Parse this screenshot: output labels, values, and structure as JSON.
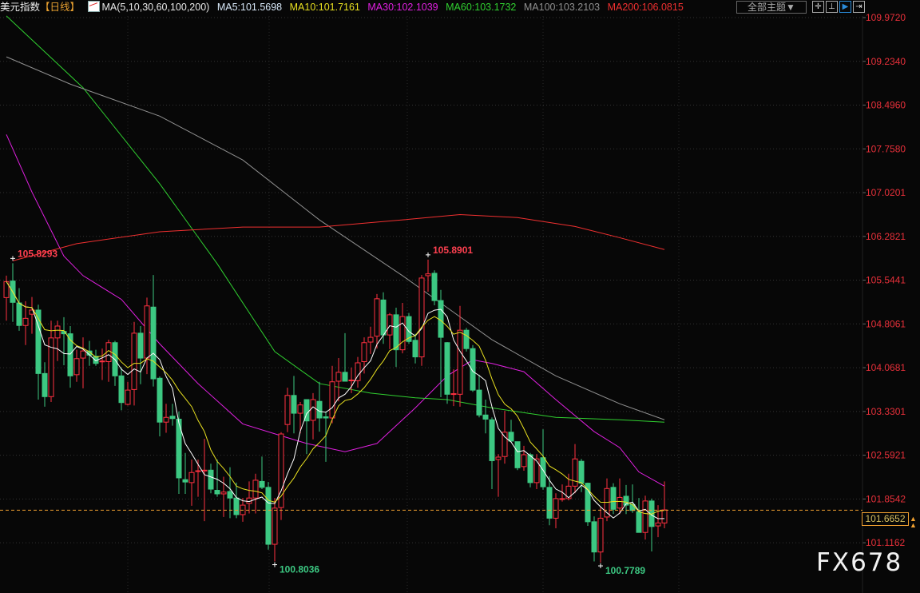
{
  "header": {
    "title": "美元指数",
    "period": "【日线】",
    "ma_spec": "MA(5,10,30,60,100,200)",
    "ma5": "MA5:101.5698",
    "ma10": "MA10:101.7161",
    "ma30": "MA30:102.1039",
    "ma60": "MA60:103.1732",
    "ma100": "MA100:103.2103",
    "ma200": "MA200:106.0815",
    "theme_button": "全部主题▼",
    "toolbar_icons": [
      "crosshair-icon",
      "range-select-icon",
      "draw-line-icon",
      "move-right-icon"
    ]
  },
  "colors": {
    "up": "#ff3040",
    "down": "#3cc882",
    "ma5": "#ffffff",
    "ma10": "#e8e020",
    "ma30": "#e020e0",
    "ma60": "#30d030",
    "ma100": "#909090",
    "ma200": "#f03030",
    "axis": "#e8303a"
  },
  "current_price": "101.6652",
  "watermark": "FX678",
  "chart_data": {
    "type": "candlestick",
    "title": "美元指数 日线",
    "ylim": [
      100.66,
      110.06
    ],
    "y_ticks": [
      "109.9720",
      "109.2340",
      "108.4960",
      "107.7580",
      "107.0201",
      "106.2821",
      "105.5441",
      "104.8061",
      "104.0681",
      "103.3301",
      "102.5921",
      "101.8542",
      "101.1162"
    ],
    "annotations": [
      {
        "bar": 2,
        "text": "105.8293",
        "type": "high"
      },
      {
        "bar": 67,
        "text": "105.8901",
        "type": "high"
      },
      {
        "bar": 43,
        "text": "100.8036",
        "type": "low"
      },
      {
        "bar": 94,
        "text": "100.7789",
        "type": "low"
      }
    ],
    "ohlc": [
      [
        105.25,
        105.62,
        104.86,
        105.52
      ],
      [
        105.53,
        105.83,
        104.84,
        105.17
      ],
      [
        105.16,
        105.41,
        104.69,
        104.78
      ],
      [
        104.78,
        105.19,
        104.45,
        104.9
      ],
      [
        104.97,
        105.26,
        104.64,
        105.04
      ],
      [
        105.04,
        105.13,
        103.53,
        103.97
      ],
      [
        103.97,
        104.16,
        103.41,
        103.58
      ],
      [
        103.58,
        104.86,
        103.49,
        104.57
      ],
      [
        104.57,
        104.86,
        104.18,
        104.77
      ],
      [
        104.68,
        104.92,
        104.11,
        104.64
      ],
      [
        104.64,
        104.77,
        103.73,
        103.93
      ],
      [
        103.95,
        104.37,
        103.83,
        104.22
      ],
      [
        104.23,
        104.58,
        103.72,
        104.35
      ],
      [
        104.35,
        104.52,
        104.1,
        104.28
      ],
      [
        104.26,
        104.37,
        104.1,
        104.14
      ],
      [
        104.17,
        104.39,
        103.86,
        104.18
      ],
      [
        104.17,
        104.54,
        103.83,
        104.49
      ],
      [
        104.49,
        104.52,
        103.76,
        103.93
      ],
      [
        103.93,
        104.07,
        103.35,
        103.48
      ],
      [
        103.45,
        103.83,
        103.43,
        103.69
      ],
      [
        103.7,
        104.84,
        103.43,
        104.65
      ],
      [
        104.65,
        104.77,
        103.79,
        104.23
      ],
      [
        104.23,
        105.25,
        103.96,
        105.11
      ],
      [
        105.09,
        105.63,
        103.75,
        103.88
      ],
      [
        103.89,
        103.92,
        102.91,
        103.15
      ],
      [
        103.15,
        103.46,
        102.97,
        103.23
      ],
      [
        103.25,
        103.46,
        103.09,
        103.21
      ],
      [
        103.2,
        103.33,
        101.94,
        102.21
      ],
      [
        102.18,
        102.63,
        101.94,
        102.14
      ],
      [
        102.13,
        102.52,
        101.74,
        102.3
      ],
      [
        102.32,
        102.52,
        101.89,
        102.33
      ],
      [
        102.33,
        102.87,
        101.48,
        102.34
      ],
      [
        102.34,
        102.45,
        101.95,
        102.02
      ],
      [
        102.0,
        102.52,
        101.89,
        101.94
      ],
      [
        101.94,
        102.23,
        101.55,
        101.97
      ],
      [
        101.98,
        102.39,
        101.53,
        101.87
      ],
      [
        101.87,
        102.13,
        101.53,
        101.59
      ],
      [
        101.59,
        101.87,
        101.47,
        101.75
      ],
      [
        101.78,
        102.15,
        101.61,
        101.87
      ],
      [
        101.87,
        102.28,
        101.61,
        102.17
      ],
      [
        102.15,
        102.57,
        102.02,
        102.05
      ],
      [
        102.05,
        102.14,
        101.0,
        101.09
      ],
      [
        101.09,
        101.87,
        100.8,
        101.7
      ],
      [
        101.71,
        102.98,
        101.5,
        102.95
      ],
      [
        103.11,
        103.73,
        102.98,
        103.6
      ],
      [
        103.6,
        103.93,
        102.96,
        103.3
      ],
      [
        103.3,
        103.49,
        102.96,
        103.44
      ],
      [
        103.53,
        103.53,
        102.61,
        103.17
      ],
      [
        103.18,
        103.64,
        102.86,
        103.53
      ],
      [
        103.5,
        103.83,
        102.99,
        103.22
      ],
      [
        103.24,
        103.33,
        102.48,
        103.22
      ],
      [
        103.22,
        104.1,
        103.13,
        103.83
      ],
      [
        103.84,
        104.23,
        103.5,
        103.99
      ],
      [
        103.99,
        104.65,
        103.84,
        103.84
      ],
      [
        103.85,
        104.07,
        103.64,
        103.86
      ],
      [
        103.85,
        104.25,
        103.73,
        104.15
      ],
      [
        104.17,
        104.58,
        103.97,
        104.49
      ],
      [
        104.5,
        104.76,
        104.3,
        104.58
      ],
      [
        104.6,
        105.31,
        104.39,
        105.23
      ],
      [
        105.21,
        105.34,
        104.47,
        104.62
      ],
      [
        104.62,
        104.99,
        104.38,
        104.96
      ],
      [
        104.96,
        105.08,
        104.08,
        104.37
      ],
      [
        104.37,
        105.16,
        104.31,
        104.93
      ],
      [
        104.93,
        104.99,
        104.47,
        104.51
      ],
      [
        104.53,
        104.64,
        104.14,
        104.25
      ],
      [
        104.25,
        105.63,
        104.1,
        105.58
      ],
      [
        105.62,
        105.89,
        105.35,
        105.65
      ],
      [
        105.66,
        105.71,
        105.12,
        105.2
      ],
      [
        105.2,
        105.38,
        103.57,
        104.58
      ],
      [
        104.49,
        104.5,
        103.46,
        103.62
      ],
      [
        103.62,
        104.04,
        103.42,
        103.63
      ],
      [
        103.62,
        105.11,
        103.41,
        104.7
      ],
      [
        104.7,
        104.74,
        104.34,
        104.39
      ],
      [
        104.39,
        104.45,
        103.66,
        103.69
      ],
      [
        103.69,
        103.95,
        103.23,
        103.27
      ],
      [
        103.27,
        103.53,
        102.96,
        103.2
      ],
      [
        103.19,
        103.23,
        102.02,
        102.5
      ],
      [
        102.52,
        102.61,
        101.89,
        102.56
      ],
      [
        102.57,
        103.34,
        102.45,
        102.98
      ],
      [
        102.98,
        103.19,
        102.81,
        102.83
      ],
      [
        102.82,
        102.82,
        102.34,
        102.38
      ],
      [
        102.4,
        102.75,
        102.33,
        102.6
      ],
      [
        102.6,
        102.63,
        102.05,
        102.13
      ],
      [
        102.13,
        102.61,
        102.02,
        102.53
      ],
      [
        102.55,
        103.03,
        102.01,
        102.06
      ],
      [
        102.05,
        102.24,
        101.41,
        101.53
      ],
      [
        101.53,
        101.95,
        101.36,
        101.86
      ],
      [
        101.85,
        102.1,
        101.81,
        101.86
      ],
      [
        101.86,
        102.28,
        101.83,
        102.07
      ],
      [
        102.07,
        102.78,
        101.95,
        102.53
      ],
      [
        102.49,
        102.53,
        101.97,
        102.12
      ],
      [
        102.12,
        102.13,
        101.4,
        101.47
      ],
      [
        101.47,
        101.56,
        100.8,
        100.96
      ],
      [
        100.96,
        101.71,
        100.78,
        101.53
      ],
      [
        101.55,
        102.2,
        101.48,
        102.03
      ],
      [
        102.05,
        102.12,
        101.6,
        101.68
      ],
      [
        101.7,
        102.2,
        101.6,
        101.88
      ],
      [
        101.9,
        102.09,
        101.6,
        101.75
      ],
      [
        101.76,
        102.1,
        101.62,
        101.66
      ],
      [
        101.64,
        101.87,
        101.29,
        101.29
      ],
      [
        101.29,
        101.91,
        101.17,
        101.82
      ],
      [
        101.82,
        101.86,
        100.97,
        101.39
      ],
      [
        101.4,
        101.75,
        101.21,
        101.45
      ],
      [
        101.45,
        102.15,
        101.36,
        101.67
      ]
    ],
    "ma_lines": {
      "ma30": [
        [
          1,
          108.0
        ],
        [
          5,
          107.03
        ],
        [
          10,
          105.95
        ],
        [
          13,
          105.62
        ],
        [
          19,
          105.22
        ],
        [
          25,
          104.47
        ],
        [
          31,
          103.8
        ],
        [
          38,
          103.12
        ],
        [
          44,
          102.92
        ],
        [
          48,
          102.79
        ],
        [
          54,
          102.65
        ],
        [
          59,
          102.79
        ],
        [
          65,
          103.39
        ],
        [
          70,
          103.93
        ],
        [
          74,
          104.2
        ],
        [
          77,
          104.14
        ],
        [
          82,
          104.0
        ],
        [
          87,
          103.53
        ],
        [
          93,
          102.99
        ],
        [
          97,
          102.72
        ],
        [
          100,
          102.31
        ],
        [
          104,
          102.07
        ]
      ],
      "ma60": [
        [
          1,
          110.0
        ],
        [
          13,
          108.79
        ],
        [
          25,
          107.17
        ],
        [
          34,
          105.82
        ],
        [
          43,
          104.34
        ],
        [
          50,
          103.8
        ],
        [
          58,
          103.64
        ],
        [
          65,
          103.56
        ],
        [
          70,
          103.53
        ],
        [
          77,
          103.39
        ],
        [
          87,
          103.23
        ],
        [
          97,
          103.19
        ],
        [
          104,
          103.15
        ]
      ],
      "ma100": [
        [
          1,
          109.31
        ],
        [
          11,
          108.85
        ],
        [
          25,
          108.31
        ],
        [
          38,
          107.57
        ],
        [
          50,
          106.56
        ],
        [
          63,
          105.62
        ],
        [
          70,
          105.08
        ],
        [
          77,
          104.54
        ],
        [
          87,
          103.93
        ],
        [
          97,
          103.46
        ],
        [
          104,
          103.19
        ]
      ],
      "ma200": [
        [
          2,
          105.87
        ],
        [
          12,
          106.16
        ],
        [
          25,
          106.36
        ],
        [
          38,
          106.44
        ],
        [
          50,
          106.44
        ],
        [
          63,
          106.56
        ],
        [
          72,
          106.65
        ],
        [
          81,
          106.6
        ],
        [
          90,
          106.45
        ],
        [
          97,
          106.26
        ],
        [
          104,
          106.06
        ]
      ]
    }
  }
}
